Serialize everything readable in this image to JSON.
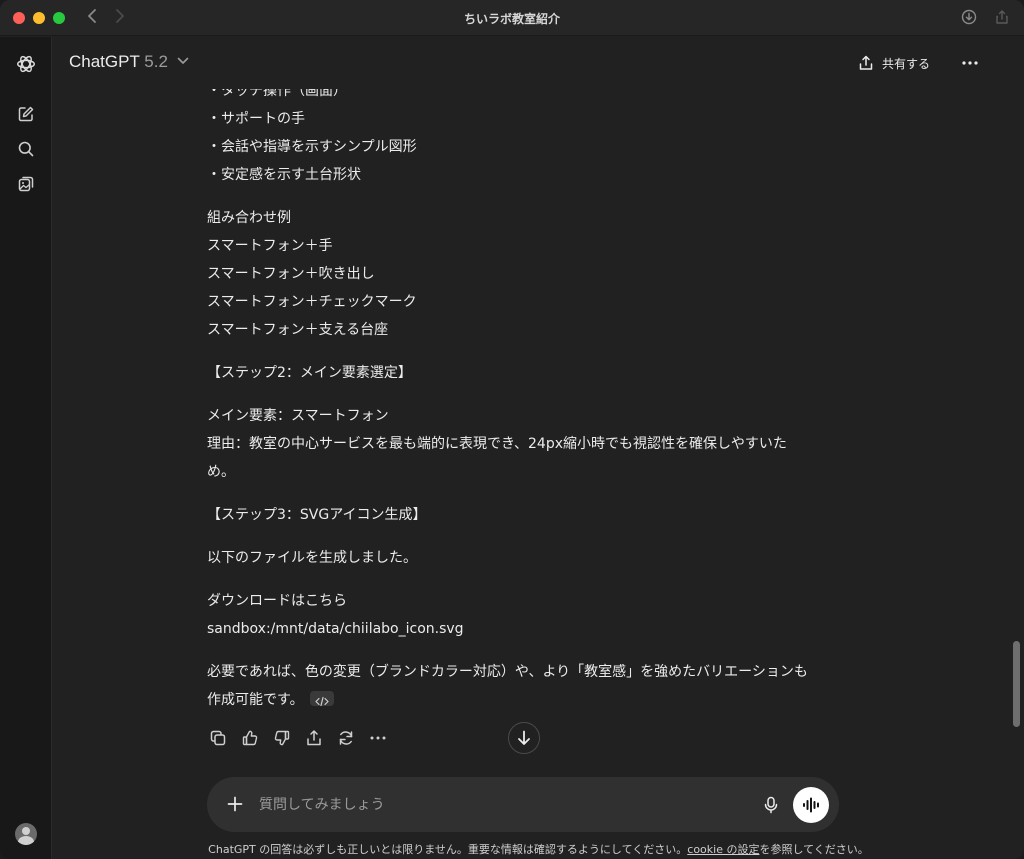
{
  "window": {
    "title": "ちいラボ教室紹介"
  },
  "header": {
    "model_name": "ChatGPT",
    "model_version": "5.2",
    "share_label": "共有する"
  },
  "message": {
    "lines": [
      "・タッチ操作（画面）",
      "・サポートの手",
      "・会話や指導を示すシンプル図形",
      "・安定感を示す土台形状",
      "",
      "組み合わせ例",
      "スマートフォン＋手",
      "スマートフォン＋吹き出し",
      "スマートフォン＋チェックマーク",
      "スマートフォン＋支える台座",
      "",
      "【ステップ2：メイン要素選定】",
      "",
      "メイン要素：スマートフォン",
      "理由：教室の中心サービスを最も端的に表現でき、24px縮小時でも視認性を確保しやすいた",
      "め。",
      "",
      "【ステップ3：SVGアイコン生成】",
      "",
      "以下のファイルを生成しました。",
      "",
      "ダウンロードはこちら",
      "sandbox:/mnt/data/chiilabo_icon.svg",
      "",
      "必要であれば、色の変更（ブランドカラー対応）や、より「教室感」を強めたバリエーションも",
      "作成可能です。"
    ]
  },
  "composer": {
    "placeholder": "質問してみましょう"
  },
  "footer": {
    "before": "ChatGPT の回答は必ずしも正しいとは限りません。重要な情報は確認するようにしてください。",
    "link": "cookie の設定",
    "after": "を参照してください。"
  },
  "icons": {
    "rail": [
      "openai-logo",
      "new-chat",
      "search",
      "images"
    ],
    "actions": [
      "copy",
      "thumbs-up",
      "thumbs-down",
      "share",
      "regenerate",
      "more"
    ]
  }
}
